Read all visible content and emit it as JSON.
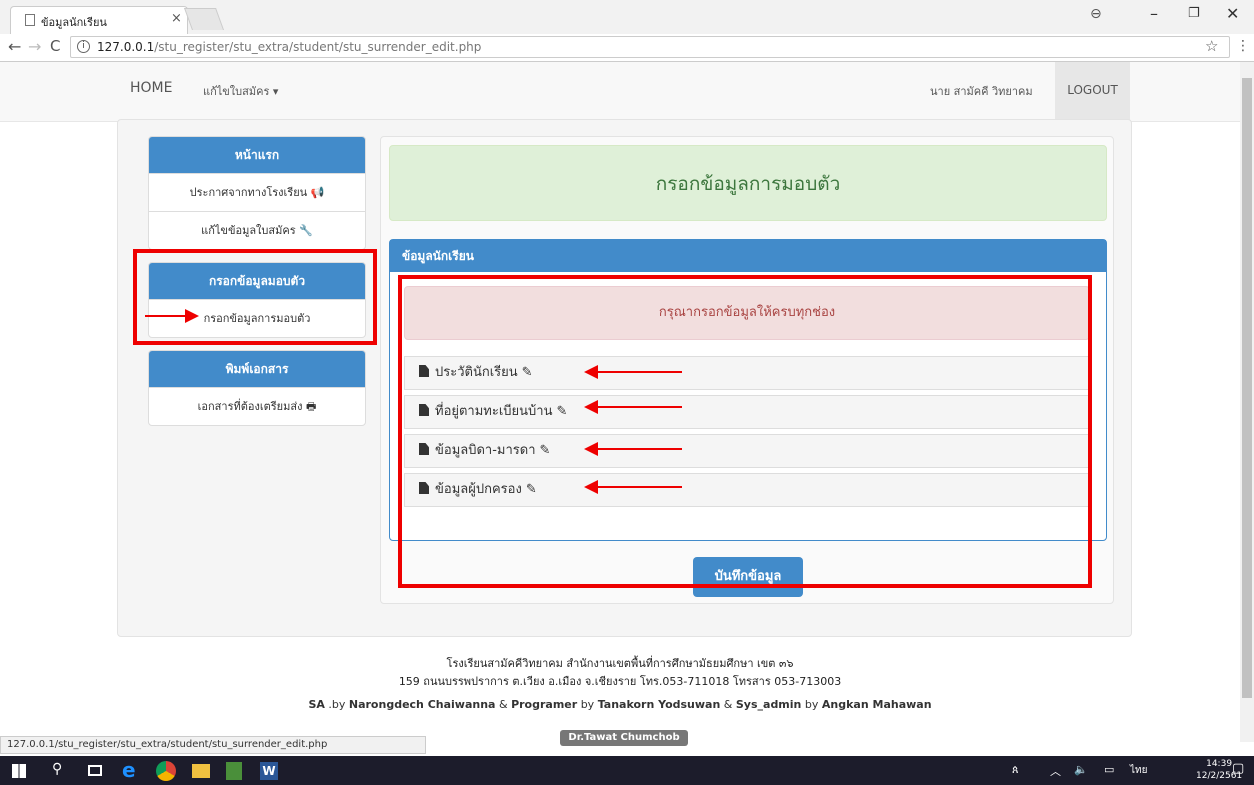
{
  "browser": {
    "tab_title": "ข้อมูลนักเรียน",
    "tab_close": "×",
    "url_host": "127.0.0.1",
    "url_path": "/stu_register/stu_extra/student/stu_surrender_edit.php",
    "status_url": "127.0.0.1/stu_register/stu_extra/student/stu_surrender_edit.php"
  },
  "navbar": {
    "home": "HOME",
    "edit_menu": "แก้ไขใบสมัคร ▾",
    "user": "นาย สามัคคี วิทยาคม",
    "logout": "LOGOUT"
  },
  "sidebar": {
    "panel1": {
      "title": "หน้าแรก",
      "items": [
        "ประกาศจากทางโรงเรียน 📢",
        "แก้ไขข้อมูลใบสมัคร 🔧"
      ]
    },
    "panel2": {
      "title": "กรอกข้อมูลมอบตัว",
      "items": [
        "กรอกข้อมูลการมอบตัว"
      ]
    },
    "panel3": {
      "title": "พิมพ์เอกสาร",
      "items": [
        "เอกสารที่ต้องเตรียมส่ง 🖶"
      ]
    }
  },
  "main": {
    "heading": "กรอกข้อมูลการมอบตัว",
    "panel_title": "ข้อมูลนักเรียน",
    "warning": "กรุณากรอกข้อมูลให้ครบทุกช่อง",
    "rows": [
      "ประวัตินักเรียน",
      "ที่อยู่ตามทะเบียนบ้าน",
      "ข้อมูลบิดา-มารดา",
      "ข้อมูลผู้ปกครอง"
    ],
    "save_button": "บันทึกข้อมูล"
  },
  "footer": {
    "line1": "โรงเรียนสามัคคีวิทยาคม สำนักงานเขตพื้นที่การศึกษามัธยมศึกษา เขต ๓๖",
    "line2": "159 ถนนบรรพปราการ ต.เวียง อ.เมือง จ.เชียงราย โทร.053-711018 โทรสาร 053-713003",
    "sa_label": "SA",
    "by1": ".by",
    "name1": "Narongdech Chaiwanna",
    "amp": "&",
    "prog_label": "Programer",
    "by2": "by",
    "name2": "Tanakorn Yodsuwan",
    "sys_label": "Sys_admin",
    "by3": "by",
    "name3": "Angkan Mahawan",
    "badge": "Dr.Tawat Chumchob"
  },
  "taskbar": {
    "time": "14:39",
    "date": "12/2/2561",
    "lang": "ไทย"
  },
  "colors": {
    "primary": "#428bca",
    "annotation": "#e00000",
    "success_bg": "#dff0d8",
    "danger_bg": "#f2dede"
  }
}
